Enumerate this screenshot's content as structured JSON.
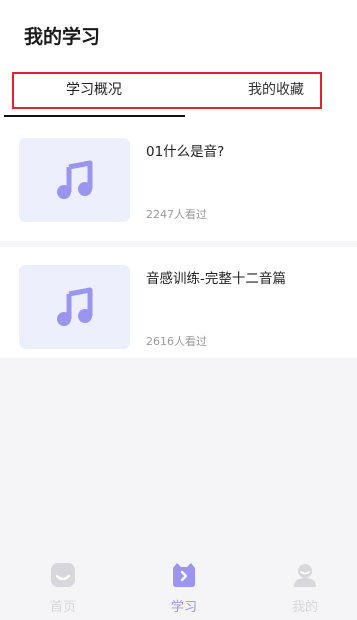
{
  "page": {
    "title": "我的学习"
  },
  "tabs": [
    {
      "label": "学习概况",
      "active": true
    },
    {
      "label": "我的收藏",
      "active": false
    }
  ],
  "items": [
    {
      "title": "01什么是音?",
      "views": "2247人看过",
      "icon": "music-note-icon"
    },
    {
      "title": "音感训练-完整十二音篇",
      "views": "2616人看过",
      "icon": "music-note-icon"
    }
  ],
  "tabbar": [
    {
      "label": "首页",
      "icon": "home-icon",
      "active": false
    },
    {
      "label": "学习",
      "icon": "study-icon",
      "active": true
    },
    {
      "label": "我的",
      "icon": "profile-icon",
      "active": false
    }
  ],
  "colors": {
    "accent": "#9b95f0",
    "highlight_box": "#e0242c",
    "thumb_bg": "#eeeffc"
  }
}
